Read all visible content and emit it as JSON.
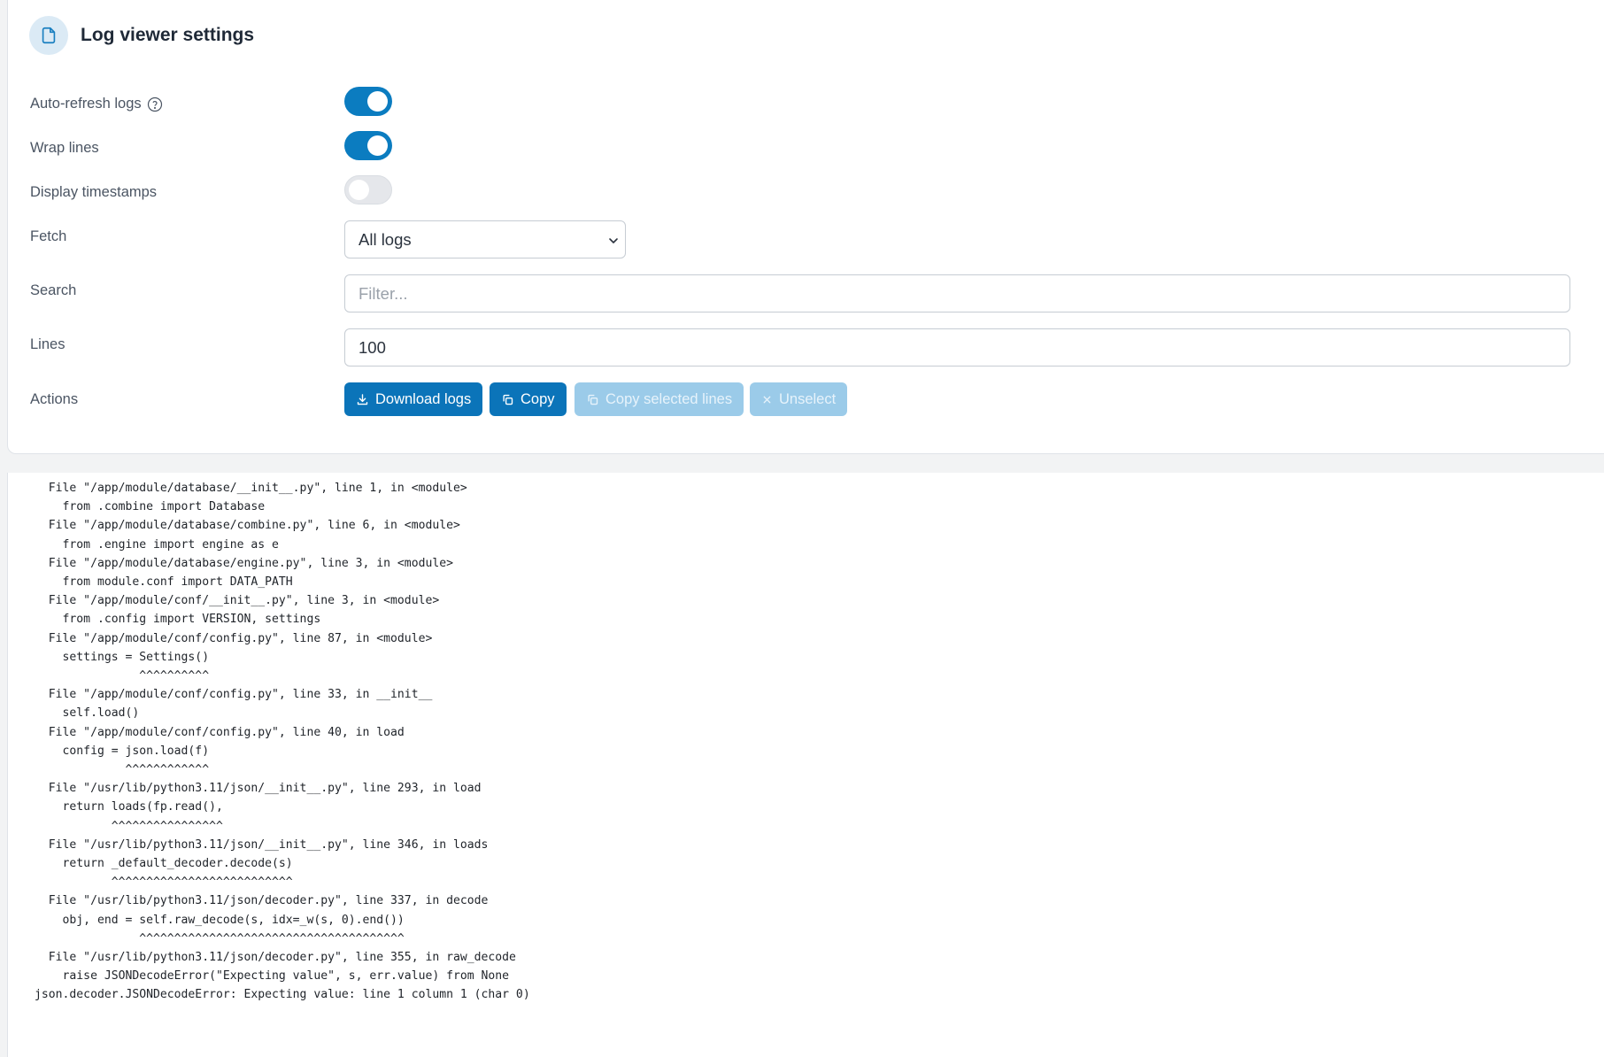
{
  "header": {
    "title": "Log viewer settings",
    "icon": "file-icon"
  },
  "settings": {
    "auto_refresh": {
      "label": "Auto-refresh logs",
      "enabled": true
    },
    "wrap_lines": {
      "label": "Wrap lines",
      "enabled": true
    },
    "display_timestamps": {
      "label": "Display timestamps",
      "enabled": false
    },
    "fetch": {
      "label": "Fetch",
      "selected": "All logs"
    },
    "search": {
      "label": "Search",
      "placeholder": "Filter..."
    },
    "lines": {
      "label": "Lines",
      "value": "100"
    },
    "actions": {
      "label": "Actions"
    }
  },
  "buttons": {
    "download": "Download logs",
    "copy": "Copy",
    "copy_selected": "Copy selected lines",
    "unselect": "Unselect"
  },
  "colors": {
    "accent": "#0b74b9",
    "toggle_on": "#0b7cc0",
    "disabled": "#9bcbe9"
  },
  "log_lines": [
    "  File \"/app/module/database/__init__.py\", line 1, in <module>",
    "    from .combine import Database",
    "  File \"/app/module/database/combine.py\", line 6, in <module>",
    "    from .engine import engine as e",
    "  File \"/app/module/database/engine.py\", line 3, in <module>",
    "    from module.conf import DATA_PATH",
    "  File \"/app/module/conf/__init__.py\", line 3, in <module>",
    "    from .config import VERSION, settings",
    "  File \"/app/module/conf/config.py\", line 87, in <module>",
    "    settings = Settings()",
    "               ^^^^^^^^^^",
    "  File \"/app/module/conf/config.py\", line 33, in __init__",
    "    self.load()",
    "  File \"/app/module/conf/config.py\", line 40, in load",
    "    config = json.load(f)",
    "             ^^^^^^^^^^^^",
    "  File \"/usr/lib/python3.11/json/__init__.py\", line 293, in load",
    "    return loads(fp.read(),",
    "           ^^^^^^^^^^^^^^^^",
    "  File \"/usr/lib/python3.11/json/__init__.py\", line 346, in loads",
    "    return _default_decoder.decode(s)",
    "           ^^^^^^^^^^^^^^^^^^^^^^^^^^",
    "  File \"/usr/lib/python3.11/json/decoder.py\", line 337, in decode",
    "    obj, end = self.raw_decode(s, idx=_w(s, 0).end())",
    "               ^^^^^^^^^^^^^^^^^^^^^^^^^^^^^^^^^^^^^^",
    "  File \"/usr/lib/python3.11/json/decoder.py\", line 355, in raw_decode",
    "    raise JSONDecodeError(\"Expecting value\", s, err.value) from None",
    "json.decoder.JSONDecodeError: Expecting value: line 1 column 1 (char 0)"
  ]
}
